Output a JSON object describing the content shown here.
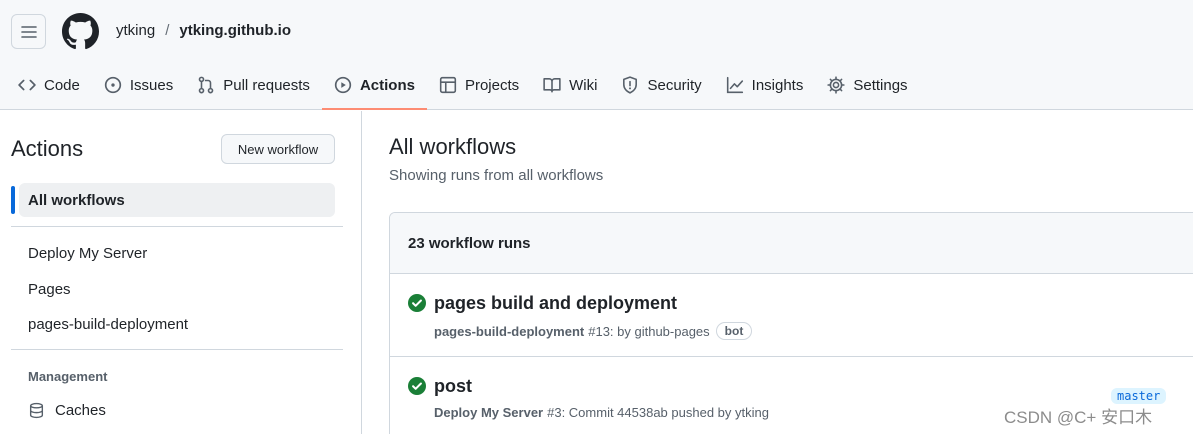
{
  "header": {
    "owner": "ytking",
    "separator": "/",
    "repo": "ytking.github.io"
  },
  "tabs": [
    {
      "label": "Code",
      "icon": "code-icon"
    },
    {
      "label": "Issues",
      "icon": "issue-icon"
    },
    {
      "label": "Pull requests",
      "icon": "pull-request-icon"
    },
    {
      "label": "Actions",
      "icon": "play-icon",
      "active": true
    },
    {
      "label": "Projects",
      "icon": "table-icon"
    },
    {
      "label": "Wiki",
      "icon": "book-icon"
    },
    {
      "label": "Security",
      "icon": "shield-icon"
    },
    {
      "label": "Insights",
      "icon": "graph-icon"
    },
    {
      "label": "Settings",
      "icon": "gear-icon"
    }
  ],
  "sidebar": {
    "title": "Actions",
    "new_workflow_label": "New workflow",
    "active_item": "All workflows",
    "workflows": [
      "Deploy My Server",
      "Pages",
      "pages-build-deployment"
    ],
    "management_heading": "Management",
    "management_items": [
      {
        "label": "Caches",
        "icon": "database-icon"
      }
    ]
  },
  "main": {
    "title": "All workflows",
    "subtitle": "Showing runs from all workflows",
    "runs_count_label": "23 workflow runs",
    "runs": [
      {
        "title": "pages build and deployment",
        "workflow": "pages-build-deployment",
        "detail": "#13: by github-pages",
        "badge": "bot",
        "status": "success"
      },
      {
        "title": "post",
        "workflow": "Deploy My Server",
        "detail": "#3: Commit 44538ab pushed by ytking",
        "branch": "master",
        "status": "success"
      }
    ]
  },
  "watermark": "CSDN @C+ 安口木",
  "colors": {
    "accent_underline": "#fd8c73",
    "success": "#1a7f37",
    "active_bar": "#0969da"
  }
}
